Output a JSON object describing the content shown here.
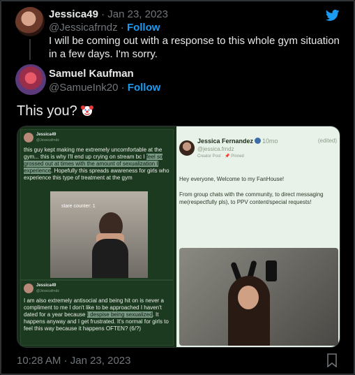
{
  "quoted": {
    "name": "Jessica49",
    "separator": " · ",
    "date": "Jan 23, 2023",
    "handle": "@Jessicafrndz",
    "follow": "Follow",
    "text": "I will be coming out with a response to this whole gym situation in a few days. I'm sorry."
  },
  "author": {
    "name": "Samuel Kaufman",
    "handle": "@SamueInk20",
    "follow": "Follow"
  },
  "tweet": {
    "text": "This you?"
  },
  "media": {
    "left_top": {
      "name": "Jessica49",
      "handle": "@Jessicafrndz",
      "text_a": "this guy kept making me extremely uncomfortable at the gym... this is why I'll end up crying on stream bc I ",
      "text_hl": "feel so grossed out at times with the amount of sexualization I experience",
      "text_b": ". Hopefully this spreads awareness for girls who experience this type of treatment at the gym",
      "photo_caption": "stare counter: 1"
    },
    "left_bottom": {
      "name": "Jessica49",
      "handle": "@Jessicafrndz",
      "text_a": "I am also extremely antisocial and being hit on is never a compliment to me I don't like to be approached I haven't dated for a year because ",
      "text_hl": "I despise being sexualized",
      "text_b": ". It happens anyway and I get frustrated. It's normal for girls to feel this way because it happens OFTEN? (6/?)"
    },
    "right": {
      "name": "Jessica Fernandez",
      "time": "10mo",
      "edited": "(edited)",
      "handle": "@jessica.frndz",
      "creator": "Creator Post",
      "pinned": "Pinned",
      "greeting": "Hey everyone, Welcome to my FanHouse!",
      "body": "From group chats with the community, to direct messaging me(respectfully pls), to PPV content/special requests!"
    }
  },
  "footer": {
    "time": "10:28 AM",
    "separator": " · ",
    "date": "Jan 23, 2023"
  },
  "colors": {
    "link": "#1d9bf0",
    "muted": "#71767b",
    "text": "#e7e9ea",
    "background": "#000000"
  },
  "icons": [
    "twitter-logo-icon",
    "clown-emoji-icon",
    "verified-icon",
    "bookmark-icon"
  ]
}
